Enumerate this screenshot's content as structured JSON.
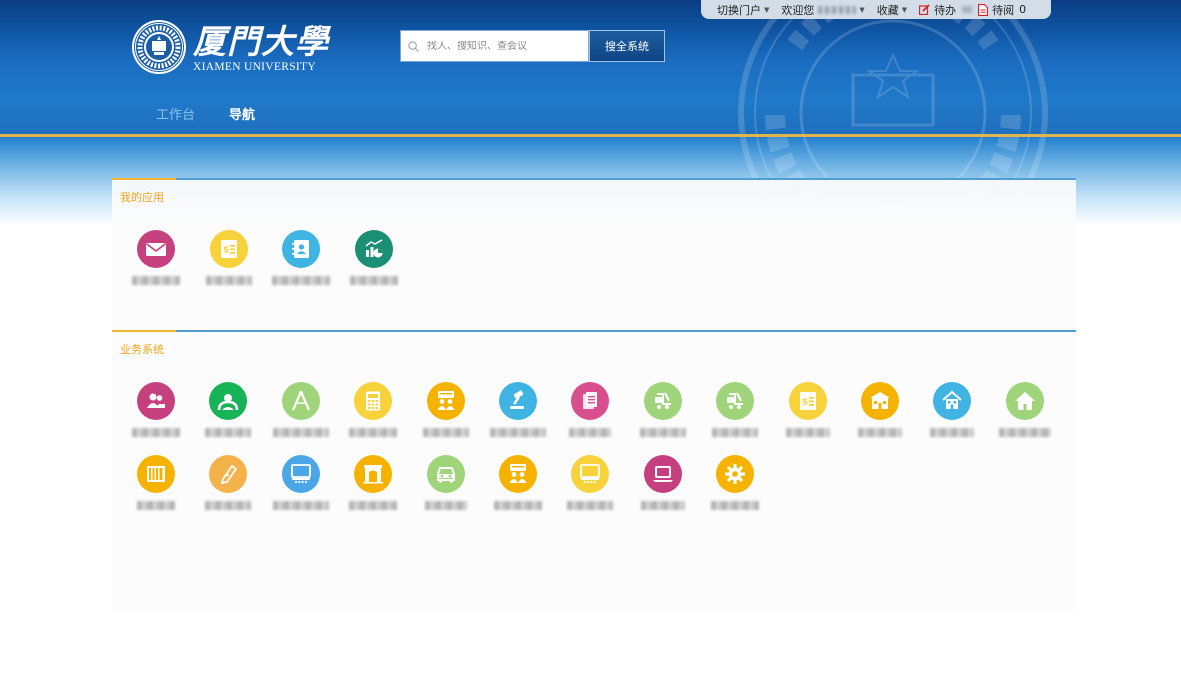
{
  "topbar": {
    "switch_portal": "切换门户",
    "welcome": "欢迎您",
    "favorites": "收藏",
    "todo": "待办",
    "toread": "待阅",
    "toread_count": "0"
  },
  "logo": {
    "cn": "厦門大學",
    "en": "XIAMEN UNIVERSITY"
  },
  "search": {
    "placeholder": "找人、搜知识、查会议",
    "button": "搜全系统"
  },
  "nav": {
    "workbench": "工作台",
    "navigation": "导航"
  },
  "sections": {
    "my_apps": {
      "title": "我的应用"
    },
    "business": {
      "title": "业务系统"
    }
  },
  "colors": {
    "accent_gold": "#f5b62e",
    "rule_blue": "#4e9bd6",
    "banner_blue": "#1a6cc0"
  },
  "my_apps": [
    {
      "icon": "mail-icon",
      "color": "#c63f7e"
    },
    {
      "icon": "finance-doc-icon",
      "color": "#f7d23a"
    },
    {
      "icon": "contacts-icon",
      "color": "#3fb4e3"
    },
    {
      "icon": "analytics-icon",
      "color": "#1a8f73"
    }
  ],
  "business_systems": [
    {
      "icon": "people-icon",
      "color": "#c63f7e"
    },
    {
      "icon": "user-circle-icon",
      "color": "#16b456"
    },
    {
      "icon": "compass-icon",
      "color": "#a0d47a"
    },
    {
      "icon": "calculator-icon",
      "color": "#f7d23a"
    },
    {
      "icon": "meeting-icon",
      "color": "#f5b300"
    },
    {
      "icon": "gavel-icon",
      "color": "#3fb4e3"
    },
    {
      "icon": "documents-icon",
      "color": "#d94e8c"
    },
    {
      "icon": "cart-icon",
      "color": "#a0d47a"
    },
    {
      "icon": "cart-icon",
      "color": "#a0d47a"
    },
    {
      "icon": "finance-doc-icon",
      "color": "#f7d23a"
    },
    {
      "icon": "building-icon",
      "color": "#f5b300"
    },
    {
      "icon": "house-building-icon",
      "color": "#3fb4e3"
    },
    {
      "icon": "home-icon",
      "color": "#a0d47a"
    },
    {
      "icon": "library-icon",
      "color": "#f5b300"
    },
    {
      "icon": "pen-icon",
      "color": "#f5b24a"
    },
    {
      "icon": "presentation-icon",
      "color": "#4aa6e6"
    },
    {
      "icon": "archway-icon",
      "color": "#f5b300"
    },
    {
      "icon": "car-icon",
      "color": "#a0d47a"
    },
    {
      "icon": "meeting-icon",
      "color": "#f5b300"
    },
    {
      "icon": "board-icon",
      "color": "#f7d23a"
    },
    {
      "icon": "laptop-icon",
      "color": "#c63f7e"
    },
    {
      "icon": "gear-icon",
      "color": "#f5b300"
    }
  ]
}
